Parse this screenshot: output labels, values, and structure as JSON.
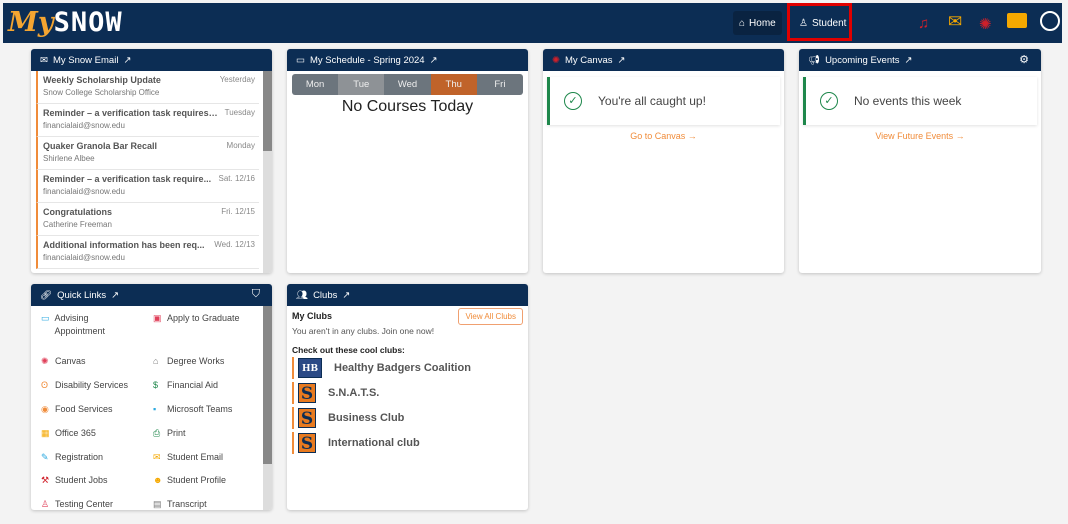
{
  "header": {
    "logo_my": "My",
    "logo_snow": "SNOW",
    "home": "Home",
    "student": "Student",
    "icons": [
      "bell-icon",
      "mail-icon",
      "canvas-icon",
      "id-card-icon",
      "profile-icon"
    ]
  },
  "email": {
    "title": "My Snow Email",
    "items": [
      {
        "subject": "Weekly Scholarship Update",
        "from": "Snow College Scholarship Office",
        "date": "Yesterday"
      },
      {
        "subject": "Reminder – a verification task requires ...",
        "from": "financialaid@snow.edu",
        "date": "Tuesday"
      },
      {
        "subject": "Quaker Granola Bar Recall",
        "from": "Shirlene Albee",
        "date": "Monday"
      },
      {
        "subject": "Reminder – a verification task require...",
        "from": "financialaid@snow.edu",
        "date": "Sat. 12/16"
      },
      {
        "subject": "Congratulations",
        "from": "Catherine Freeman",
        "date": "Fri. 12/15"
      },
      {
        "subject": "Additional information has been req...",
        "from": "financialaid@snow.edu",
        "date": "Wed. 12/13"
      }
    ]
  },
  "schedule": {
    "title": "My Schedule - Spring 2024",
    "days": [
      "Mon",
      "Tue",
      "Wed",
      "Thu",
      "Fri"
    ],
    "selected": "Thu",
    "message": "No Courses Today"
  },
  "canvas": {
    "title": "My Canvas",
    "message": "You're all caught up!",
    "link": "Go to Canvas →"
  },
  "events": {
    "title": "Upcoming Events",
    "message": "No events this week",
    "link": "View Future Events →"
  },
  "quick_links": {
    "title": "Quick Links",
    "items": [
      {
        "label": "Advising Appointment",
        "icon": "▭",
        "color": "#29a8e0"
      },
      {
        "label": "Apply to Graduate",
        "icon": "▣",
        "color": "#e0405a"
      },
      {
        "label": "Canvas",
        "icon": "✺",
        "color": "#e0405a"
      },
      {
        "label": "Degree Works",
        "icon": "⌂",
        "color": "#777"
      },
      {
        "label": "Disability Services",
        "icon": "ʘ",
        "color": "#f08c3a"
      },
      {
        "label": "Financial Aid",
        "icon": "$",
        "color": "#1e874b"
      },
      {
        "label": "Food Services",
        "icon": "◉",
        "color": "#f08c3a"
      },
      {
        "label": "Microsoft Teams",
        "icon": "▪",
        "color": "#29a8e0"
      },
      {
        "label": "Office 365",
        "icon": "▦",
        "color": "#f5a800"
      },
      {
        "label": "Print",
        "icon": "⎙",
        "color": "#1e874b"
      },
      {
        "label": "Registration",
        "icon": "✎",
        "color": "#29a8e0"
      },
      {
        "label": "Student Email",
        "icon": "✉",
        "color": "#f5a800"
      },
      {
        "label": "Student Jobs",
        "icon": "⚒",
        "color": "#d0202a"
      },
      {
        "label": "Student Profile",
        "icon": "☻",
        "color": "#f5a800"
      },
      {
        "label": "Testing Center",
        "icon": "♙",
        "color": "#e0405a"
      },
      {
        "label": "Transcript",
        "icon": "▤",
        "color": "#777"
      }
    ]
  },
  "clubs": {
    "title": "Clubs",
    "my_clubs": "My Clubs",
    "view_all": "View All Clubs",
    "empty": "You aren't in any clubs. Join one now!",
    "suggest": "Check out these cool clubs:",
    "items": [
      "Healthy Badgers Coalition",
      "S.N.A.T.S.",
      "Business Club",
      "International club"
    ],
    "logo_letter": "S"
  }
}
